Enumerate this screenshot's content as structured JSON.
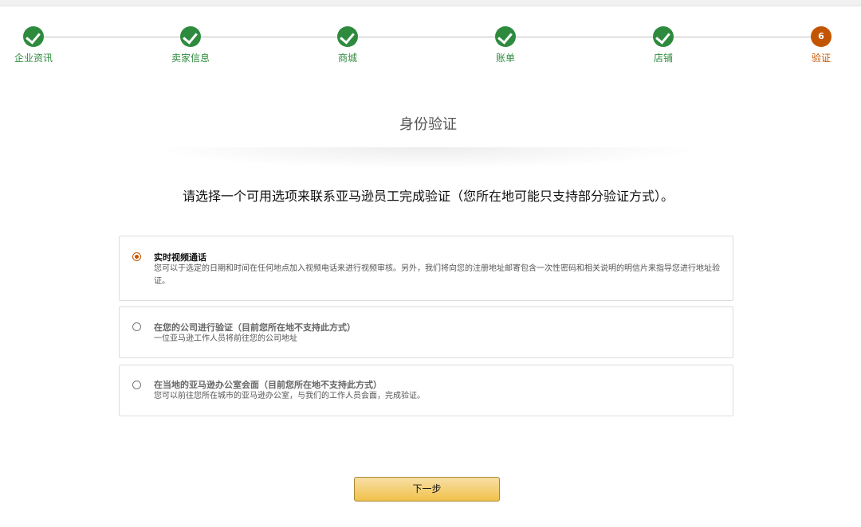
{
  "stepper": {
    "steps": [
      {
        "label": "企业资讯",
        "status": "completed"
      },
      {
        "label": "卖家信息",
        "status": "completed"
      },
      {
        "label": "商城",
        "status": "completed"
      },
      {
        "label": "账单",
        "status": "completed"
      },
      {
        "label": "店铺",
        "status": "completed"
      },
      {
        "label": "验证",
        "status": "current",
        "number": "6"
      }
    ],
    "colors": {
      "completed": "#2e8b3e",
      "current": "#c45500"
    }
  },
  "page": {
    "title": "身份验证",
    "instruction": "请选择一个可用选项来联系亚马逊员工完成验证（您所在地可能只支持部分验证方式）。"
  },
  "options": [
    {
      "title": "实时视频通话",
      "description": "您可以于选定的日期和时间在任何地点加入视频电话来进行视频审核。另外，我们将向您的注册地址邮寄包含一次性密码和相关说明的明信片来指导您进行地址验证。",
      "selected": true,
      "available": true
    },
    {
      "title": "在您的公司进行验证（目前您所在地不支持此方式）",
      "description": "一位亚马逊工作人员将前往您的公司地址",
      "selected": false,
      "available": false
    },
    {
      "title": "在当地的亚马逊办公室会面（目前您所在地不支持此方式）",
      "description": "您可以前往您所在城市的亚马逊办公室，与我们的工作人员会面，完成验证。",
      "selected": false,
      "available": false
    }
  ],
  "actions": {
    "next_label": "下一步"
  }
}
